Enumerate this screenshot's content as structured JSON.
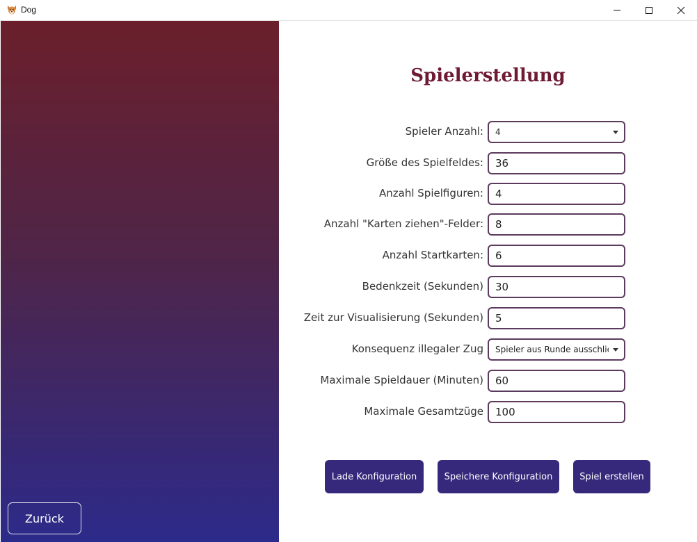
{
  "window": {
    "title": "Dog",
    "icon": "dog-icon",
    "controls": [
      "minimize-icon",
      "maximize-icon",
      "close-icon"
    ]
  },
  "colors": {
    "sidebar_top": "#6b1f2b",
    "sidebar_bottom": "#2c2a8a",
    "title": "#6e1a33",
    "field_border": "#5b3a5e",
    "button_bg": "#36297c"
  },
  "sidebar": {
    "back_label": "Zurück"
  },
  "page": {
    "title": "Spielerstellung"
  },
  "form": {
    "fields": [
      {
        "label": "Spieler Anzahl:",
        "value": "4",
        "type": "select"
      },
      {
        "label": "Größe des Spielfeldes:",
        "value": "36",
        "type": "input"
      },
      {
        "label": "Anzahl Spielfiguren:",
        "value": "4",
        "type": "input"
      },
      {
        "label": "Anzahl \"Karten ziehen\"-Felder:",
        "value": "8",
        "type": "input"
      },
      {
        "label": "Anzahl Startkarten:",
        "value": "6",
        "type": "input"
      },
      {
        "label": "Bedenkzeit (Sekunden)",
        "value": "30",
        "type": "input"
      },
      {
        "label": "Zeit zur Visualisierung (Sekunden)",
        "value": "5",
        "type": "input"
      },
      {
        "label": "Konsequenz illegaler Zug",
        "value": "Spieler aus Runde ausschließen",
        "type": "select"
      },
      {
        "label": "Maximale Spieldauer (Minuten)",
        "value": "60",
        "type": "input"
      },
      {
        "label": "Maximale Gesamtzüge",
        "value": "100",
        "type": "input"
      }
    ]
  },
  "actions": {
    "load_label": "Lade Konfiguration",
    "save_label": "Speichere Konfiguration",
    "create_label": "Spiel erstellen"
  }
}
